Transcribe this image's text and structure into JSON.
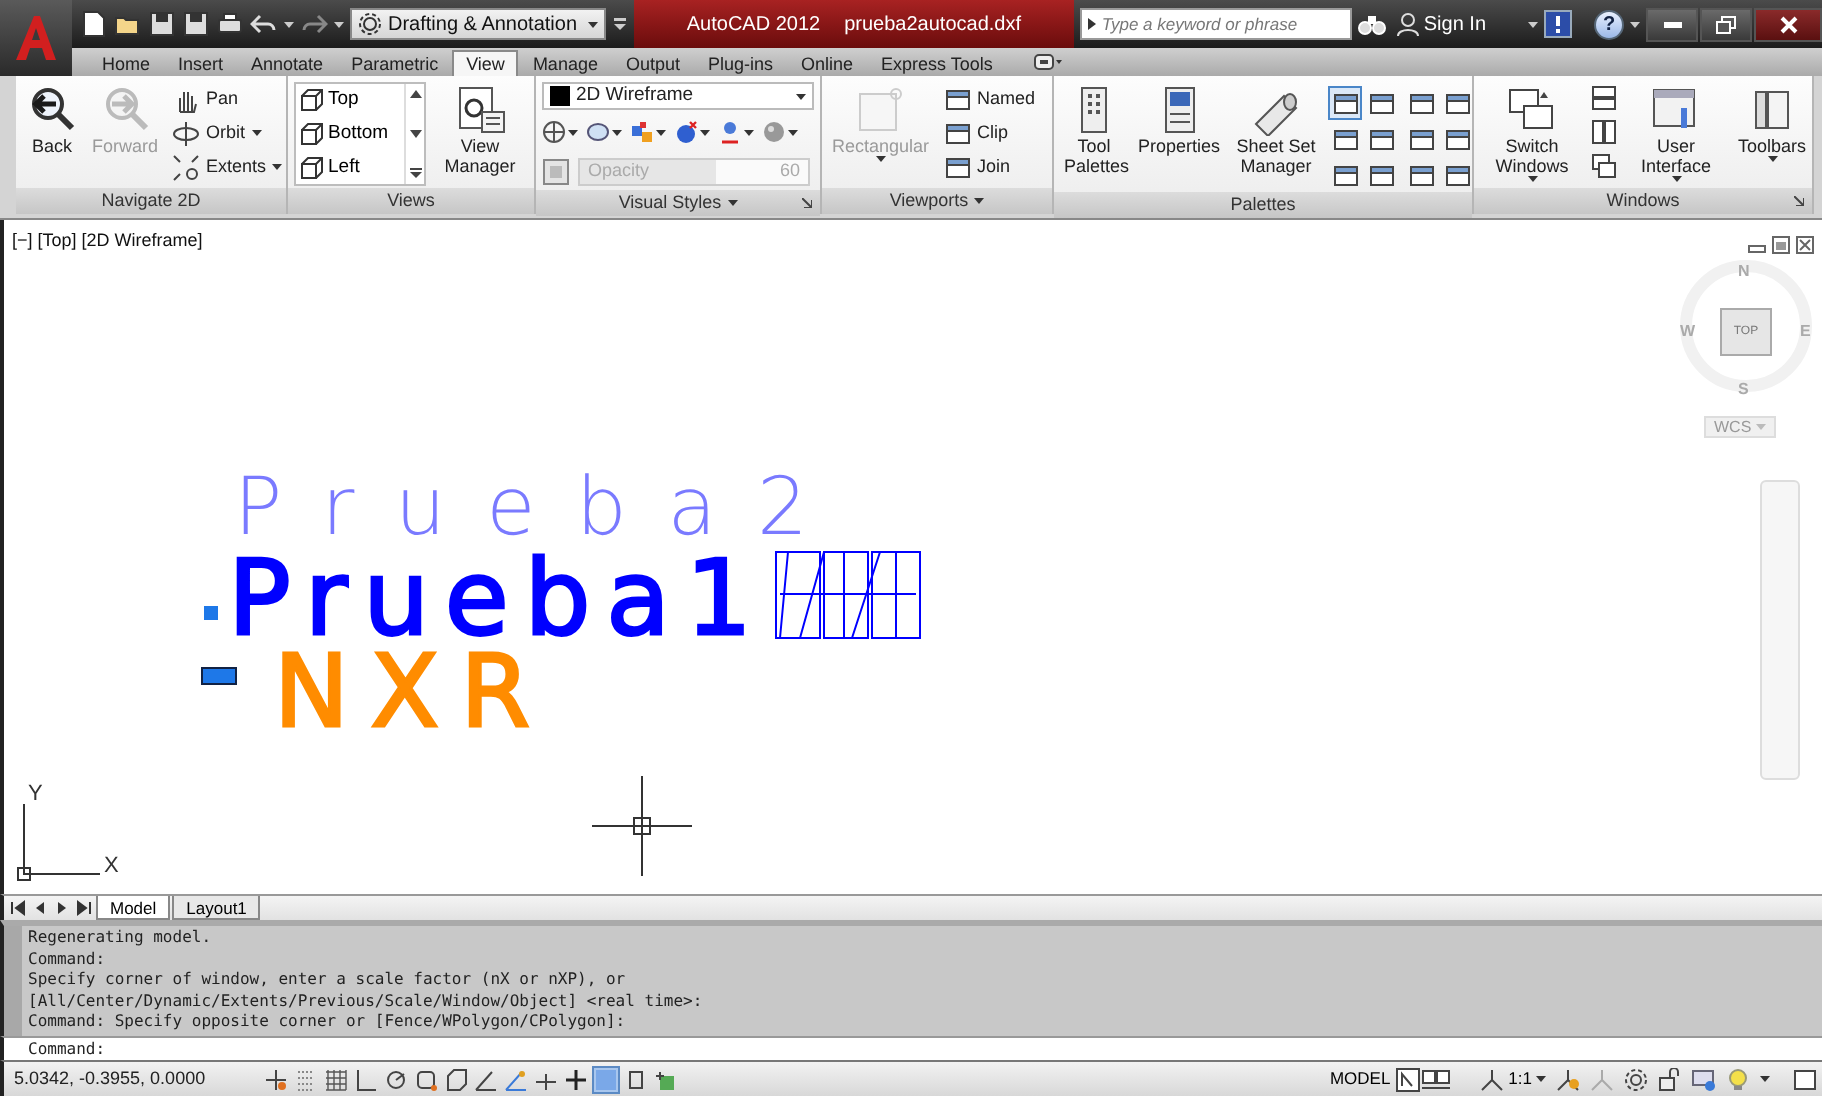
{
  "title_bar": {
    "workspace": "Drafting & Annotation",
    "app_name": "AutoCAD 2012",
    "file_name": "prueba2autocad.dxf",
    "search": {
      "placeholder": "Type a keyword or phrase"
    },
    "sign_in": "Sign In",
    "help": "?"
  },
  "ribbon_tabs": [
    {
      "label": "Home",
      "selected": false
    },
    {
      "label": "Insert",
      "selected": false
    },
    {
      "label": "Annotate",
      "selected": false
    },
    {
      "label": "Parametric",
      "selected": false
    },
    {
      "label": "View",
      "selected": true
    },
    {
      "label": "Manage",
      "selected": false
    },
    {
      "label": "Output",
      "selected": false
    },
    {
      "label": "Plug-ins",
      "selected": false
    },
    {
      "label": "Online",
      "selected": false
    },
    {
      "label": "Express Tools",
      "selected": false
    }
  ],
  "panels": [
    {
      "kind": "navigate",
      "title": "Navigate 2D",
      "buttons": [
        {
          "label": "Back",
          "disabled": false
        },
        {
          "label": "Forward",
          "disabled": true
        }
      ],
      "tools": [
        {
          "label": "Pan",
          "has_menu": false
        },
        {
          "label": "Orbit",
          "has_menu": true
        },
        {
          "label": "Extents",
          "has_menu": true
        }
      ]
    },
    {
      "kind": "views",
      "title": "Views",
      "views": [
        "Top",
        "Bottom",
        "Left"
      ],
      "manager": "View Manager"
    },
    {
      "kind": "visual_styles",
      "title": "Visual Styles",
      "has_menu": true,
      "launcher": true,
      "style": "2D Wireframe",
      "opacity": {
        "label": "Opacity",
        "value": "60",
        "disabled": true,
        "level": 0.6
      }
    },
    {
      "kind": "viewports",
      "title": "Viewports",
      "has_menu": true,
      "launcher": false,
      "rectangular": {
        "label": "Rectangular",
        "disabled": true
      },
      "tools": [
        "Named",
        "Clip",
        "Join"
      ]
    },
    {
      "kind": "palettes",
      "title": "Palettes",
      "buttons": [
        "Tool Palettes",
        "Properties",
        "Sheet Set Manager"
      ],
      "small_tools": [
        {
          "on": true
        },
        {
          "on": false
        },
        {
          "on": false
        },
        {
          "on": false
        },
        {
          "on": false
        },
        {
          "on": false
        },
        {
          "on": false
        },
        {
          "on": false
        },
        {
          "on": false
        },
        {
          "on": false
        },
        {
          "on": false
        },
        {
          "on": false
        }
      ]
    },
    {
      "kind": "windows",
      "title": "Windows",
      "launcher": true,
      "buttons": [
        {
          "label": "Switch Windows",
          "has_menu": true
        },
        {
          "label": "User Interface",
          "has_menu": true
        },
        {
          "label": "Toolbars",
          "has_menu": true
        }
      ]
    }
  ],
  "viewport": {
    "label": "[−] [Top] [2D Wireframe]",
    "viewcube": {
      "face": "TOP",
      "north": "N",
      "south": "S",
      "east": "E",
      "west": "W",
      "ucs_menu": "WCS"
    },
    "objects": [
      {
        "text": "Prueba2",
        "kind": "thin",
        "color": "#7a7aff"
      },
      {
        "text": "Prueba1",
        "kind": "bold",
        "color": "#0000ff"
      },
      {
        "text": "NXR",
        "kind": "bold",
        "color": "#ff8c00"
      }
    ],
    "ucs": {
      "y": "Y",
      "x": "X"
    }
  },
  "layout_tabs": [
    {
      "label": "Model",
      "selected": true
    },
    {
      "label": "Layout1",
      "selected": false
    }
  ],
  "command_history": [
    "Regenerating model.",
    "Command:",
    "Specify corner of window, enter a scale factor (nX or nXP), or",
    "[All/Center/Dynamic/Extents/Previous/Scale/Window/Object] <real time>:",
    "Command: Specify opposite corner or [Fence/WPolygon/CPolygon]:"
  ],
  "command_line": {
    "prompt": "Command:"
  },
  "status_bar": {
    "coordinates": "5.0342, -0.3955, 0.0000",
    "toggles": [
      {
        "on": false
      },
      {
        "on": false
      },
      {
        "on": false
      },
      {
        "on": false
      },
      {
        "on": false
      },
      {
        "on": false
      },
      {
        "on": false
      },
      {
        "on": false
      },
      {
        "on": false
      },
      {
        "on": false
      },
      {
        "on": false
      },
      {
        "on": true
      },
      {
        "on": false
      },
      {
        "on": false
      }
    ],
    "space": "MODEL",
    "annotation_scale": "1:1"
  }
}
